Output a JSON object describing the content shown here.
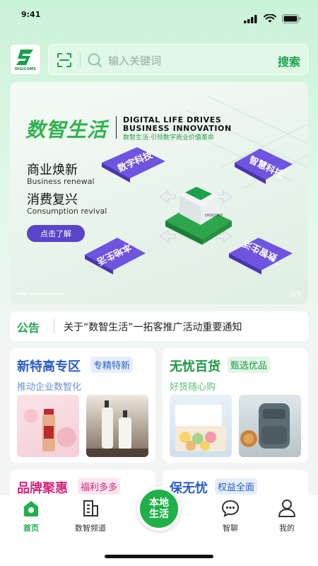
{
  "status_bar": {
    "time": "9:41"
  },
  "header": {
    "logo_text": "DIGICOMS",
    "search_placeholder": "输入关键词",
    "search_button": "搜索"
  },
  "banner": {
    "title_cn": "数智生活",
    "title_en": "DIGITAL LIFE DRIVES BUSINESS INNOVATION",
    "subtitle": "数智生活·引领数字商业价值革命",
    "line1_cn": "商业焕新",
    "line1_en": "Business renewal",
    "line2_cn": "消费复兴",
    "line2_en": "Consumption revival",
    "cta": "点击了解",
    "page": "2/5",
    "cube_text": "DIGICOMS",
    "badges": [
      "数字科技",
      "智慧科技",
      "本地生活",
      "数智生活"
    ]
  },
  "notice": {
    "label": "公告",
    "text": "关于“数智生活”一拓客推广活动重要通知"
  },
  "cards": [
    {
      "title": "新特高专区",
      "tag": "专精特新",
      "sub": "推动企业数智化",
      "title_color": "#2b5cc8",
      "tag_color": "#2b5cc8"
    },
    {
      "title": "无忧百货",
      "tag": "甄选优品",
      "sub": "好货随心购",
      "title_color": "#1a9a45",
      "tag_color": "#1a9a45"
    },
    {
      "title": "品牌聚惠",
      "tag": "福利多多",
      "title_color": "#d4297a",
      "tag_color": "#d4297a"
    },
    {
      "title": "保无忧",
      "tag": "权益全面",
      "title_color": "#2b5cc8",
      "tag_color": "#2b5cc8"
    }
  ],
  "tabs": [
    {
      "label": "首页",
      "icon": "home-icon",
      "active": true
    },
    {
      "label": "数智频道",
      "icon": "building-icon"
    },
    {
      "label": "本地生活",
      "icon": "center-button"
    },
    {
      "label": "智聊",
      "icon": "chat-icon"
    },
    {
      "label": "我的",
      "icon": "profile-icon"
    }
  ],
  "colors": {
    "brand_green": "#1fb04a",
    "accent_purple": "#5a44c9"
  }
}
